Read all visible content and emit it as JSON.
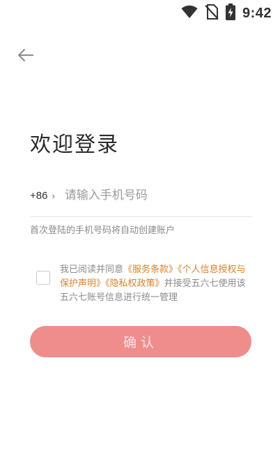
{
  "status_bar": {
    "time": "9:42",
    "icons": [
      "wifi-icon",
      "no-sim-icon",
      "battery-charging-icon"
    ]
  },
  "nav": {
    "back_icon": "arrow-left-icon"
  },
  "title": "欢迎登录",
  "phone": {
    "country_code": "+86",
    "chevron": "›",
    "placeholder": "请输入手机号码"
  },
  "hint": "首次登陆的手机号码将自动创建账户",
  "agreement": {
    "checked": false,
    "prefix": "我已阅读并同意",
    "link_service": "《服务条款》",
    "link_personal_info": "《个人信息授权与保护声明》",
    "link_privacy": "《隐私权政策》",
    "suffix": "并接受五六七使用该五六七账号信息进行统一管理"
  },
  "confirm": {
    "label": "确认"
  },
  "colors": {
    "accent_link": "#d9802e",
    "button_bg": "#ef8d8d",
    "button_text": "#fbe3e3"
  }
}
